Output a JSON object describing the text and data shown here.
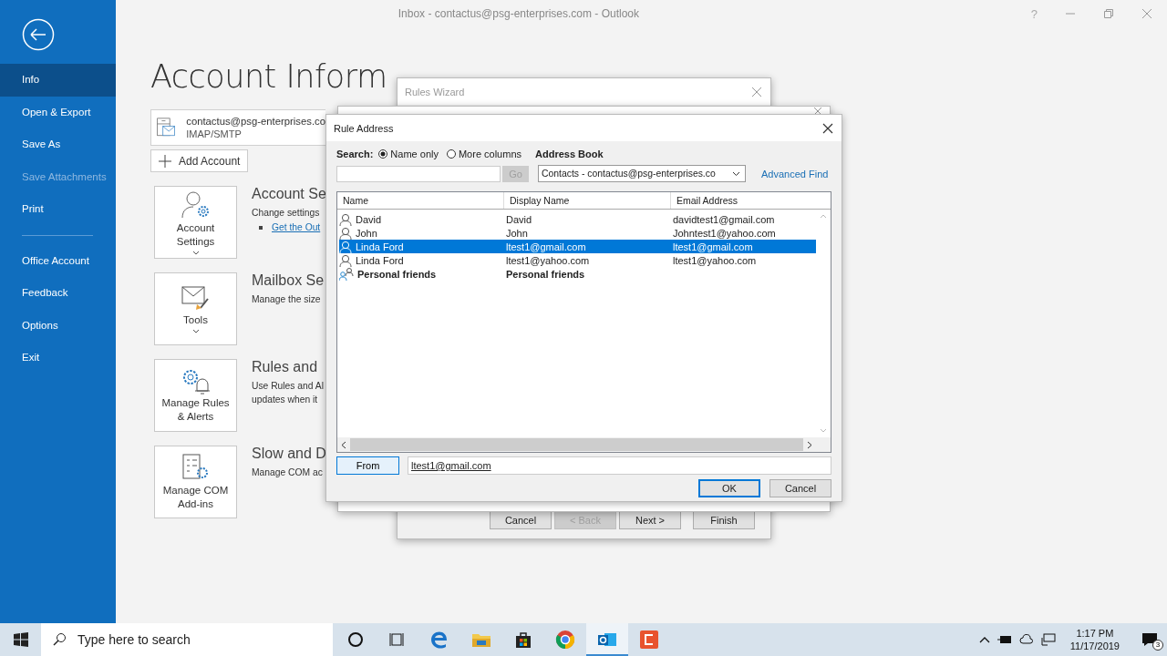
{
  "window": {
    "title": "Inbox - contactus@psg-enterprises.com - Outlook",
    "help": "?"
  },
  "sidebar": {
    "groups": [
      [
        {
          "label": "Info",
          "selected": true,
          "disabled": false
        },
        {
          "label": "Open & Export",
          "selected": false,
          "disabled": false
        },
        {
          "label": "Save As",
          "selected": false,
          "disabled": false
        },
        {
          "label": "Save Attachments",
          "selected": false,
          "disabled": true
        },
        {
          "label": "Print",
          "selected": false,
          "disabled": false
        }
      ],
      [
        {
          "label": "Office Account",
          "selected": false,
          "disabled": false
        },
        {
          "label": "Feedback",
          "selected": false,
          "disabled": false
        },
        {
          "label": "Options",
          "selected": false,
          "disabled": false
        },
        {
          "label": "Exit",
          "selected": false,
          "disabled": false
        }
      ]
    ]
  },
  "page": {
    "title": "Account Inform",
    "account": {
      "email": "contactus@psg-enterprises.co",
      "type": "IMAP/SMTP"
    },
    "add_account": "Add Account",
    "sections": [
      {
        "kind": "account",
        "button": "Account Settings",
        "caret": true,
        "title": "Account Se",
        "lines": [
          "Change settings"
        ],
        "link": "Get the Out"
      },
      {
        "kind": "tools",
        "button": "Tools",
        "caret": true,
        "title": "Mailbox Se",
        "lines": [
          "Manage the size"
        ]
      },
      {
        "kind": "rules",
        "button": "Manage Rules & Alerts",
        "caret": false,
        "title": "Rules and",
        "lines": [
          "Use Rules and Al",
          "updates when it"
        ]
      },
      {
        "kind": "com",
        "button": "Manage COM Add-ins",
        "caret": false,
        "title": "Slow and D",
        "lines": [
          "Manage COM ac"
        ]
      }
    ]
  },
  "rules_wizard": {
    "title": "Rules Wizard",
    "buttons": [
      {
        "label": "Cancel",
        "disabled": false
      },
      {
        "label": "< Back",
        "disabled": true
      },
      {
        "label": "Next >",
        "disabled": false
      },
      {
        "label": "Finish",
        "disabled": false
      }
    ]
  },
  "rule_address": {
    "title": "Rule Address",
    "search_label": "Search:",
    "search_options": [
      {
        "label": "Name only",
        "selected": true
      },
      {
        "label": "More columns",
        "selected": false
      }
    ],
    "address_book_label": "Address Book",
    "go": {
      "label": "Go",
      "disabled": true
    },
    "address_book": "Contacts - contactus@psg-enterprises.co",
    "advanced_find": "Advanced Find",
    "columns": [
      "Name",
      "Display Name",
      "Email Address"
    ],
    "rows": [
      {
        "kind": "contact",
        "name": "David",
        "display": "David",
        "email": "davidtest1@gmail.com",
        "selected": false
      },
      {
        "kind": "contact",
        "name": "John",
        "display": "John",
        "email": "Johntest1@yahoo.com",
        "selected": false
      },
      {
        "kind": "contact",
        "name": "Linda Ford",
        "display": "ltest1@gmail.com",
        "email": "ltest1@gmail.com",
        "selected": true
      },
      {
        "kind": "contact",
        "name": "Linda Ford",
        "display": "ltest1@yahoo.com",
        "email": "ltest1@yahoo.com",
        "selected": false
      },
      {
        "kind": "group",
        "name": "Personal friends",
        "display": "Personal friends",
        "selected": false
      }
    ],
    "from_button": "From",
    "from_value": "ltest1@gmail.com",
    "ok": "OK",
    "cancel": "Cancel"
  },
  "taskbar": {
    "search_placeholder": "Type here to search",
    "time": "1:17 PM",
    "date": "11/17/2019",
    "notifications": "3"
  }
}
